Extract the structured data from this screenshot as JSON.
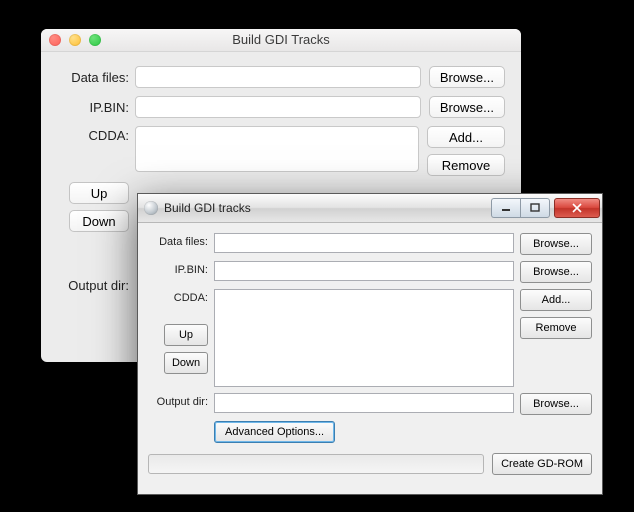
{
  "mac": {
    "title": "Build GDI Tracks",
    "labels": {
      "data_files": "Data files:",
      "ip_bin": "IP.BIN:",
      "cdda": "CDDA:",
      "output_dir": "Output dir:"
    },
    "inputs": {
      "data_files": "",
      "ip_bin": ""
    },
    "buttons": {
      "browse": "Browse...",
      "add": "Add...",
      "remove": "Remove",
      "up": "Up",
      "down": "Down"
    }
  },
  "win": {
    "title": "Build GDI tracks",
    "labels": {
      "data_files": "Data files:",
      "ip_bin": "IP.BIN:",
      "cdda": "CDDA:",
      "output_dir": "Output dir:"
    },
    "inputs": {
      "data_files": "",
      "ip_bin": "",
      "output_dir": ""
    },
    "buttons": {
      "browse": "Browse...",
      "add": "Add...",
      "remove": "Remove",
      "up": "Up",
      "down": "Down",
      "advanced": "Advanced Options...",
      "create": "Create GD-ROM"
    },
    "controls": {
      "min_glyph": "—",
      "max_glyph": "▭",
      "close_glyph": "✕"
    }
  }
}
